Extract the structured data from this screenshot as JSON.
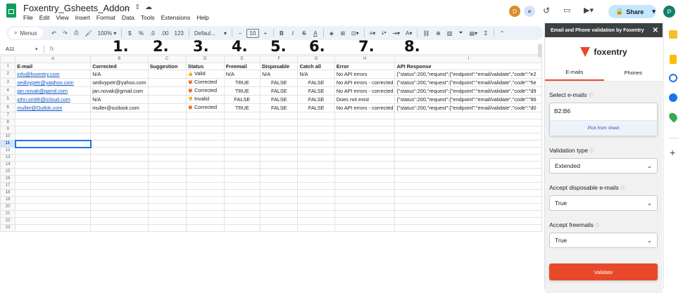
{
  "app": {
    "title": "Foxentry_Gsheets_Addon",
    "menu": [
      "File",
      "Edit",
      "View",
      "Insert",
      "Format",
      "Data",
      "Tools",
      "Extensions",
      "Help"
    ],
    "avatar_d": "D",
    "avatar_p": "P",
    "share": "Share"
  },
  "toolbar": {
    "menus": "Menus",
    "zoom": "100%",
    "dollar": "$",
    "percent": "%",
    "dec_less": ".0",
    "dec_more": ".00",
    "format123": "123",
    "font": "Defaul...",
    "font_size": "10"
  },
  "formula": {
    "cell_ref": "A11",
    "fx": "fx"
  },
  "annotations": [
    "1.",
    "2.",
    "3.",
    "4.",
    "5.",
    "6.",
    "7.",
    "8."
  ],
  "columns": [
    "A",
    "B",
    "C",
    "D",
    "E",
    "F",
    "G",
    "H",
    "I"
  ],
  "rows": [
    [
      "E-mail",
      "Corrected",
      "Suggestion",
      "Status",
      "Freemail",
      "Disposable",
      "Catch all",
      "Error",
      "API Response"
    ],
    [
      "info@foxentry.com",
      "N/A",
      "",
      "Valid",
      "N/A",
      "N/A",
      "N/A",
      "No API errors",
      "{\"status\":200,\"request\":{\"endpoint\":\"email/validate\",\"code\":\"e2"
    ],
    [
      "sedivypetr@yaghoo.com",
      "sedivypetr@yahoo.com",
      "",
      "Corrected",
      "TRUE",
      "FALSE",
      "FALSE",
      "No API errors - corrected",
      "{\"status\":200,\"request\":{\"endpoint\":\"email/validate\",\"code\":\"5e"
    ],
    [
      "jan.novak@gamil.com",
      "jan.novak@gmail.com",
      "",
      "Corrected",
      "TRUE",
      "FALSE",
      "FALSE",
      "No API errors - corrected",
      "{\"status\":200,\"request\":{\"endpoint\":\"email/validate\",\"code\":\"d9"
    ],
    [
      "john.smith@icloud.com",
      "N/A",
      "",
      "Invalid",
      "FALSE",
      "FALSE",
      "FALSE",
      "Does not exist",
      "{\"status\":200,\"request\":{\"endpoint\":\"email/validate\",\"code\":\"96"
    ],
    [
      "muller@Outlok.com",
      "muller@outlook.com",
      "",
      "Corrected",
      "TRUE",
      "FALSE",
      "FALSE",
      "No API errors - corrected",
      "{\"status\":200,\"request\":{\"endpoint\":\"email/validate\",\"code\":\"d0"
    ]
  ],
  "row_count": 23,
  "panel": {
    "title": "Email and Phone validation by Foxentry",
    "brand": "foxentry",
    "tab_emails": "E-mails",
    "tab_phones": "Phones",
    "select_label": "Select e-mails",
    "range": "B2:B6",
    "pick": "Pick from sheet",
    "validation_label": "Validation type",
    "validation_value": "Extended",
    "disposable_label": "Accept disposable e-mails",
    "disposable_value": "True",
    "freemail_label": "Accept freemails",
    "freemail_value": "True",
    "validate": "Validate"
  },
  "colors": {
    "accent": "#e8492a",
    "toolbar_bg": "#edf2fa",
    "panel_head": "#3c4043",
    "link": "#1155cc"
  }
}
